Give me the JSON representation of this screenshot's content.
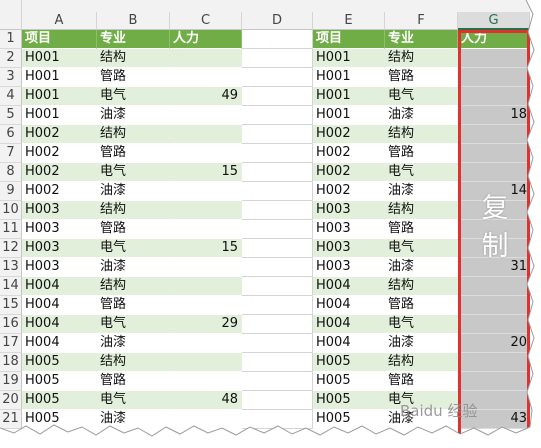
{
  "sheet": {
    "columns": [
      "A",
      "B",
      "C",
      "D",
      "E",
      "F",
      "G"
    ],
    "selected_column": "G",
    "header_row": [
      "项目",
      "专业",
      "人力"
    ],
    "left_rows": [
      [
        "H001",
        "结构",
        ""
      ],
      [
        "H001",
        "管路",
        ""
      ],
      [
        "H001",
        "电气",
        "49"
      ],
      [
        "H001",
        "油漆",
        ""
      ],
      [
        "H002",
        "结构",
        ""
      ],
      [
        "H002",
        "管路",
        ""
      ],
      [
        "H002",
        "电气",
        "15"
      ],
      [
        "H002",
        "油漆",
        ""
      ],
      [
        "H003",
        "结构",
        ""
      ],
      [
        "H003",
        "管路",
        ""
      ],
      [
        "H003",
        "电气",
        "15"
      ],
      [
        "H003",
        "油漆",
        ""
      ],
      [
        "H004",
        "结构",
        ""
      ],
      [
        "H004",
        "管路",
        ""
      ],
      [
        "H004",
        "电气",
        "29"
      ],
      [
        "H004",
        "油漆",
        ""
      ],
      [
        "H005",
        "结构",
        ""
      ],
      [
        "H005",
        "管路",
        ""
      ],
      [
        "H005",
        "电气",
        "48"
      ],
      [
        "H005",
        "油漆",
        ""
      ]
    ],
    "right_rows": [
      [
        "H001",
        "结构",
        ""
      ],
      [
        "H001",
        "管路",
        ""
      ],
      [
        "H001",
        "电气",
        ""
      ],
      [
        "H001",
        "油漆",
        "18"
      ],
      [
        "H002",
        "结构",
        ""
      ],
      [
        "H002",
        "管路",
        ""
      ],
      [
        "H002",
        "电气",
        ""
      ],
      [
        "H002",
        "油漆",
        "14"
      ],
      [
        "H003",
        "结构",
        ""
      ],
      [
        "H003",
        "管路",
        ""
      ],
      [
        "H003",
        "电气",
        ""
      ],
      [
        "H003",
        "油漆",
        "31"
      ],
      [
        "H004",
        "结构",
        ""
      ],
      [
        "H004",
        "管路",
        ""
      ],
      [
        "H004",
        "电气",
        ""
      ],
      [
        "H004",
        "油漆",
        "20"
      ],
      [
        "H005",
        "结构",
        ""
      ],
      [
        "H005",
        "管路",
        ""
      ],
      [
        "H005",
        "电气",
        ""
      ],
      [
        "H005",
        "油漆",
        "43"
      ]
    ]
  },
  "annotation": {
    "copy_text": "复制",
    "highlight_color": "#e03030"
  },
  "watermark": {
    "text": "Baidu 经验"
  },
  "colors": {
    "header_green": "#70ad47",
    "band_light": "#e2efda",
    "selected_fill": "#c8c8c8"
  }
}
